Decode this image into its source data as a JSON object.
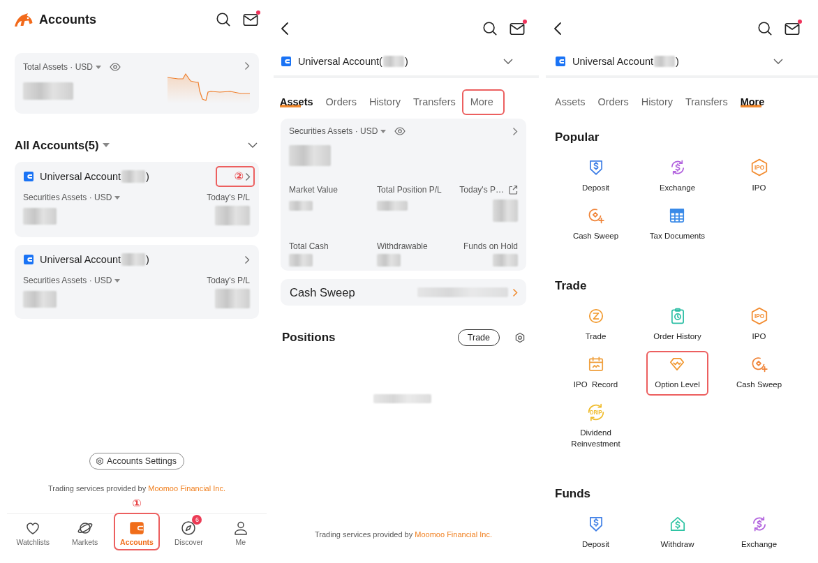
{
  "accounts_screen": {
    "header": {
      "title": "Accounts",
      "unread_mail": true
    },
    "total_assets": {
      "label": "Total Assets · USD"
    },
    "all_accounts": {
      "title": "All Accounts(5)"
    },
    "accounts": [
      {
        "name": "Universal Account",
        "tail": ")",
        "assets_label": "Securities Assets · USD",
        "pl_label": "Today's P/L",
        "highlighted": true,
        "callout": "②"
      },
      {
        "name": "Universal Account",
        "tail": ")",
        "assets_label": "Securities Assets · USD",
        "pl_label": "Today's P/L",
        "highlighted": false
      }
    ],
    "settings_button": "Accounts Settings",
    "footer": {
      "text": "Trading services provided by",
      "link": "Moomoo Financial Inc."
    },
    "tab_bar": [
      {
        "label": "Watchlists",
        "selected": false,
        "highlighted": false
      },
      {
        "label": "Markets",
        "selected": false,
        "highlighted": false
      },
      {
        "label": "Accounts",
        "selected": true,
        "highlighted": true,
        "callout": "①"
      },
      {
        "label": "Discover",
        "selected": false,
        "highlighted": false,
        "badge": "6"
      },
      {
        "label": "Me",
        "selected": false,
        "highlighted": false
      }
    ]
  },
  "assets_screen": {
    "header": {
      "unread_mail": true
    },
    "account": {
      "name": "Universal Account(",
      "tail": ")"
    },
    "tabs": [
      {
        "label": "Assets",
        "selected": true,
        "highlighted": false
      },
      {
        "label": "Orders",
        "selected": false,
        "highlighted": false
      },
      {
        "label": "History",
        "selected": false,
        "highlighted": false
      },
      {
        "label": "Transfers",
        "selected": false,
        "highlighted": false
      },
      {
        "label": "More",
        "selected": false,
        "highlighted": true
      }
    ],
    "securities": {
      "label": "Securities Assets · USD",
      "metrics": [
        "Market Value",
        "Total Position P/L",
        "Today's P…",
        "Total Cash",
        "Withdrawable",
        "Funds on Hold"
      ]
    },
    "cash_sweep": {
      "label": "Cash Sweep"
    },
    "positions": {
      "title": "Positions",
      "button": "Trade"
    },
    "footer": {
      "text": "Trading services provided by",
      "link": "Moomoo Financial Inc."
    }
  },
  "more_screen": {
    "header": {
      "unread_mail": true
    },
    "account": {
      "name": "Universal Account",
      "tail": ")"
    },
    "tabs": [
      {
        "label": "Assets",
        "selected": false,
        "highlighted": false
      },
      {
        "label": "Orders",
        "selected": false,
        "highlighted": false
      },
      {
        "label": "History",
        "selected": false,
        "highlighted": false
      },
      {
        "label": "Transfers",
        "selected": false,
        "highlighted": false
      },
      {
        "label": "More",
        "selected": true,
        "highlighted": false
      }
    ],
    "sections": [
      {
        "title": "Popular",
        "items": [
          {
            "label": "Deposit",
            "kind": "deposit",
            "color": "#3f7fe6",
            "highlighted": false
          },
          {
            "label": "Exchange",
            "kind": "exchange",
            "color": "#b263de",
            "highlighted": false
          },
          {
            "label": "IPO",
            "kind": "ipo",
            "icon_text": "IPO",
            "color": "#f28c30",
            "highlighted": false
          },
          {
            "label": "Cash Sweep",
            "kind": "sweep",
            "color": "#f08438",
            "highlighted": false
          },
          {
            "label": "Tax Documents",
            "kind": "tax",
            "color": "#3a8ae8",
            "highlighted": false
          }
        ]
      },
      {
        "title": "Trade",
        "items": [
          {
            "label": "Trade",
            "kind": "trade",
            "color": "#f29a2e",
            "highlighted": false
          },
          {
            "label": "Order History",
            "kind": "orders",
            "color": "#2fbfa6",
            "highlighted": false
          },
          {
            "label": "IPO",
            "kind": "ipo",
            "icon_text": "IPO",
            "color": "#f28c30",
            "highlighted": false
          },
          {
            "label": "IPO  Record",
            "kind": "record",
            "color": "#f0a03e",
            "highlighted": false
          },
          {
            "label": "Option Level",
            "kind": "option",
            "color": "#f0952c",
            "highlighted": true
          },
          {
            "label": "Cash Sweep",
            "kind": "sweep",
            "color": "#f08438",
            "highlighted": false
          },
          {
            "label": "Dividend Reinvestment",
            "kind": "drip",
            "icon_text": "DRIP",
            "color": "#f0bc2c",
            "highlighted": false
          }
        ]
      },
      {
        "title": "Funds",
        "items": [
          {
            "label": "Deposit",
            "kind": "deposit",
            "color": "#3f7fe6",
            "highlighted": false
          },
          {
            "label": "Withdraw",
            "kind": "withdraw",
            "color": "#2cc3a2",
            "highlighted": false
          },
          {
            "label": "Exchange",
            "kind": "exchange",
            "color": "#b263de",
            "highlighted": false
          }
        ]
      }
    ]
  }
}
